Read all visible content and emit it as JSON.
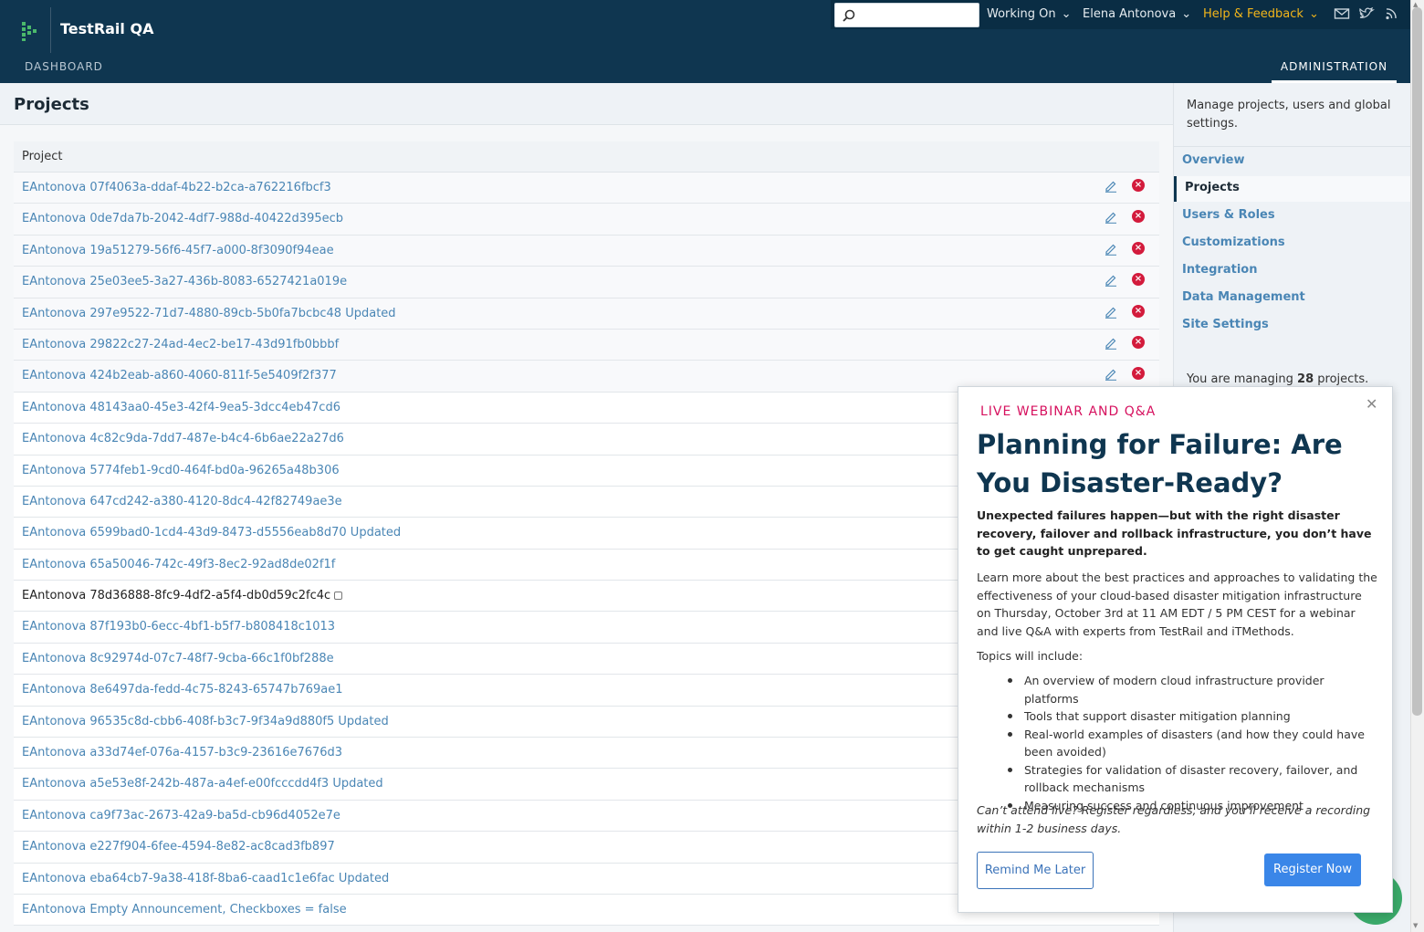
{
  "header": {
    "app_title": "TestRail QA",
    "search_placeholder": "",
    "working_on": "Working On",
    "user_name": "Elena Antonova",
    "help": "Help & Feedback",
    "nav_dashboard": "DASHBOARD",
    "nav_administration": "ADMINISTRATION"
  },
  "page": {
    "title": "Projects",
    "column_header": "Project"
  },
  "projects": [
    "EAntonova 07f4063a-ddaf-4b22-b2ca-a762216fbcf3",
    "EAntonova 0de7da7b-2042-4df7-988d-40422d395ecb",
    "EAntonova 19a51279-56f6-45f7-a000-8f3090f94eae",
    "EAntonova 25e03ee5-3a27-436b-8083-6527421a019e",
    "EAntonova 297e9522-71d7-4880-89cb-5b0fa7bcbc48 Updated",
    "EAntonova 29822c27-24ad-4ec2-be17-43d91fb0bbbf",
    "EAntonova 424b2eab-a860-4060-811f-5e5409f2f377",
    "EAntonova 48143aa0-45e3-42f4-9ea5-3dcc4eb47cd6",
    "EAntonova 4c82c9da-7dd7-487e-b4c4-6b6ae22a27d6",
    "EAntonova 5774feb1-9cd0-464f-bd0a-96265a48b306",
    "EAntonova 647cd242-a380-4120-8dc4-42f82749ae3e",
    "EAntonova 6599bad0-1cd4-43d9-8473-d5556eab8d70 Updated",
    "EAntonova 65a50046-742c-49f3-8ec2-92ad8de02f1f",
    "EAntonova 78d36888-8fc9-4df2-a5f4-db0d59c2fc4c",
    "EAntonova 87f193b0-6ecc-4bf1-b5f7-b808418c1013",
    "EAntonova 8c92974d-07c7-48f7-9cba-66c1f0bf288e",
    "EAntonova 8e6497da-fedd-4c75-8243-65747b769ae1",
    "EAntonova 96535c8d-cbb6-408f-b3c7-9f34a9d880f5 Updated",
    "EAntonova a33d74ef-076a-4157-b3c9-23616e7676d3",
    "EAntonova a5e53e8f-242b-487a-a4ef-e00fcccdd4f3 Updated",
    "EAntonova ca9f73ac-2673-42a9-ba5d-cb96d4052e7e",
    "EAntonova e227f904-6fee-4594-8e82-ac8cad3fb897",
    "EAntonova eba64cb7-9a38-418f-8ba6-caad1c1e6fac Updated",
    "EAntonova Empty Announcement, Checkboxes = false"
  ],
  "sidebar": {
    "description": "Manage projects, users and global settings.",
    "items": [
      "Overview",
      "Projects",
      "Users & Roles",
      "Customizations",
      "Integration",
      "Data Management",
      "Site Settings"
    ],
    "managing_prefix": "You are managing ",
    "managing_count": "28",
    "managing_suffix": " projects."
  },
  "popup": {
    "kicker": "LIVE WEBINAR AND Q&A",
    "title": "Planning for Failure: Are You Disaster-Ready?",
    "lead": "Unexpected failures happen—but with the right disaster recovery, failover and rollback infrastructure, you don’t have to get caught unprepared.",
    "body": "Learn more about the best practices and approaches to validating the effectiveness of your cloud-based disaster mitigation infrastructure on Thursday, October 3rd at 11 AM EDT / 5 PM CEST for a webinar and live Q&A with experts from TestRail and iTMethods.",
    "topics_label": "Topics will include:",
    "topics": [
      "An overview of modern cloud infrastructure provider platforms",
      "Tools that support disaster mitigation planning",
      "Real-world examples of disasters (and how they could have been avoided)",
      "Strategies for validation of disaster recovery, failover, and rollback mechanisms",
      "Measuring success and continuous improvement"
    ],
    "note": "Can’t attend live? Register regardless, and you’ll receive a recording within 1-2 business days.",
    "remind_label": "Remind Me Later",
    "register_label": "Register Now",
    "close_glyph": "✕"
  },
  "colors": {
    "header_bg": "#0f3650",
    "link": "#4a86b5",
    "accent_pink": "#d6105e",
    "help_yellow": "#f2b51a",
    "register_blue": "#3a86e8"
  }
}
